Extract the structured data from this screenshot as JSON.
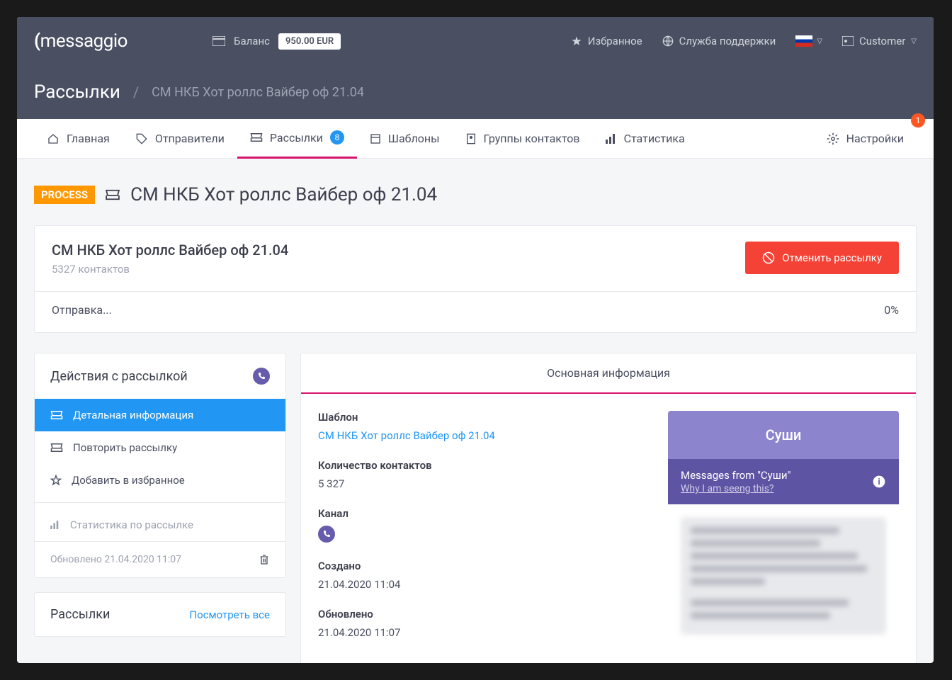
{
  "brand": "messaggio",
  "balance": {
    "label": "Баланс",
    "amount": "950.00 EUR"
  },
  "top_links": {
    "favorites": "Избранное",
    "support": "Служба поддержки",
    "user": "Customer"
  },
  "breadcrumb": {
    "root": "Рассылки",
    "current": "СМ НКБ Хот роллс Вайбер оф 21.04"
  },
  "tabs": {
    "home": "Главная",
    "senders": "Отправители",
    "campaigns": "Рассылки",
    "campaigns_badge": "8",
    "templates": "Шаблоны",
    "groups": "Группы контактов",
    "stats": "Статистика",
    "settings": "Настройки",
    "settings_notif": "1"
  },
  "status": "PROCESS",
  "title": "СМ НКБ Хот роллс Вайбер оф 21.04",
  "summary": {
    "name": "СМ НКБ Хот роллс Вайбер оф 21.04",
    "contacts": "5327 контактов",
    "cancel": "Отменить рассылку",
    "sending": "Отправка...",
    "percent": "0%"
  },
  "actions": {
    "title": "Действия с рассылкой",
    "detail": "Детальная информация",
    "repeat": "Повторить рассылку",
    "favorite": "Добавить в избранное",
    "stats": "Статистика по рассылке",
    "updated": "Обновлено 21.04.2020 11:07"
  },
  "related": {
    "title": "Рассылки",
    "view_all": "Посмотреть все"
  },
  "info": {
    "head": "Основная информация",
    "template_label": "Шаблон",
    "template_val": "СМ НКБ Хот роллс Вайбер оф 21.04",
    "count_label": "Количество контактов",
    "count_val": "5 327",
    "channel_label": "Канал",
    "created_label": "Создано",
    "created_val": "21.04.2020 11:04",
    "updated_label": "Обновлено",
    "updated_val": "21.04.2020 11:07"
  },
  "preview": {
    "sender": "Суши",
    "from": "Messages from \"Суши\"",
    "why": "Why I am seeng this?"
  }
}
